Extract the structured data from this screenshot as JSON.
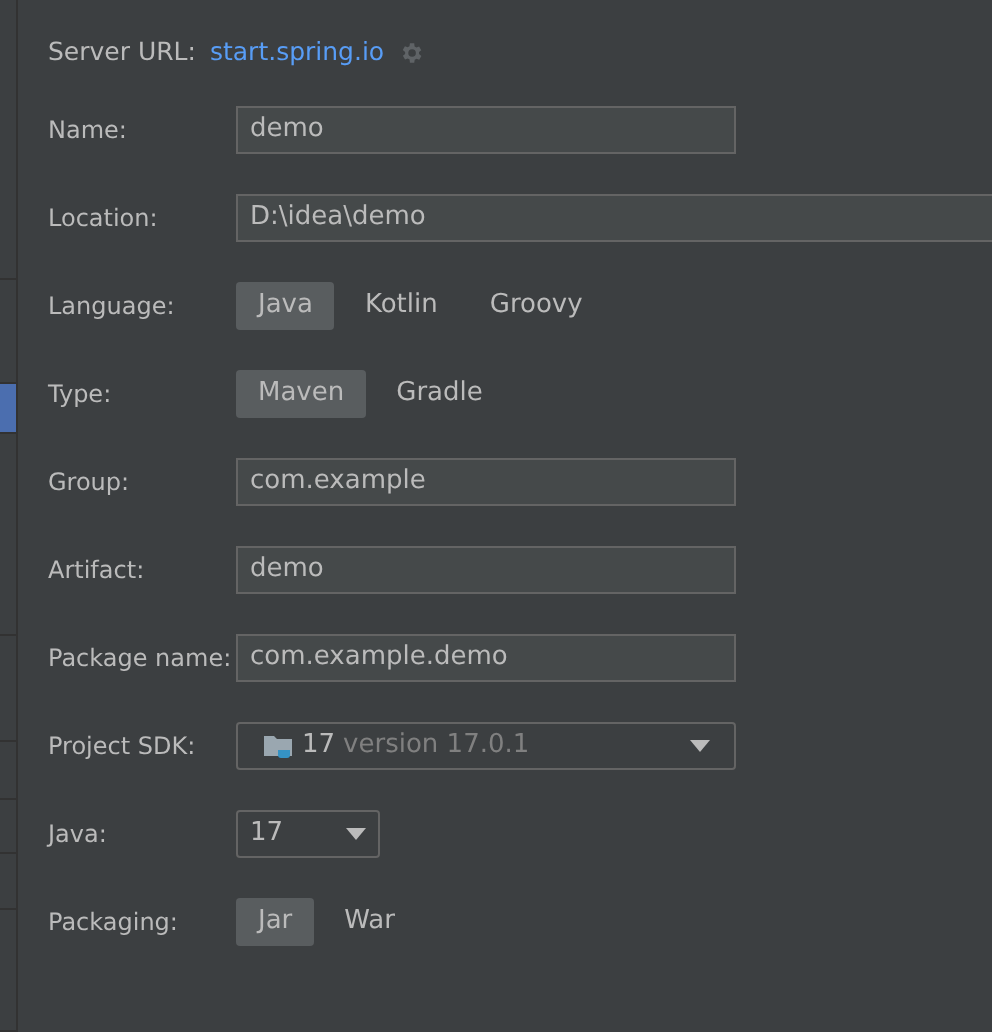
{
  "server": {
    "label": "Server URL:",
    "link": "start.spring.io"
  },
  "sidebar": {
    "items": [
      {
        "selected": false
      },
      {
        "selected": false
      },
      {
        "selected": true
      },
      {
        "selected": false
      },
      {
        "selected": false
      },
      {
        "selected": false
      },
      {
        "selected": false
      },
      {
        "selected": false
      },
      {
        "selected": false
      }
    ]
  },
  "fields": [
    {
      "kind": "text",
      "label": "Name:",
      "value": "demo"
    },
    {
      "kind": "text",
      "label": "Location:",
      "value": "D:\\idea\\demo",
      "wide": true
    },
    {
      "kind": "segmented",
      "label": "Language:",
      "options": [
        {
          "label": "Java",
          "selected": true
        },
        {
          "label": "Kotlin",
          "selected": false
        },
        {
          "label": "Groovy",
          "selected": false
        }
      ]
    },
    {
      "kind": "segmented",
      "label": "Type:",
      "options": [
        {
          "label": "Maven",
          "selected": true
        },
        {
          "label": "Gradle",
          "selected": false
        }
      ]
    },
    {
      "kind": "text",
      "label": "Group:",
      "value": "com.example"
    },
    {
      "kind": "text",
      "label": "Artifact:",
      "value": "demo"
    },
    {
      "kind": "text",
      "label": "Package name:",
      "value": "com.example.demo"
    },
    {
      "kind": "sdk",
      "label": "Project SDK:",
      "value": "17",
      "detail": "version 17.0.1"
    },
    {
      "kind": "combo",
      "label": "Java:",
      "value": "17"
    },
    {
      "kind": "segmented",
      "label": "Packaging:",
      "options": [
        {
          "label": "Jar",
          "selected": true
        },
        {
          "label": "War",
          "selected": false
        }
      ]
    }
  ]
}
